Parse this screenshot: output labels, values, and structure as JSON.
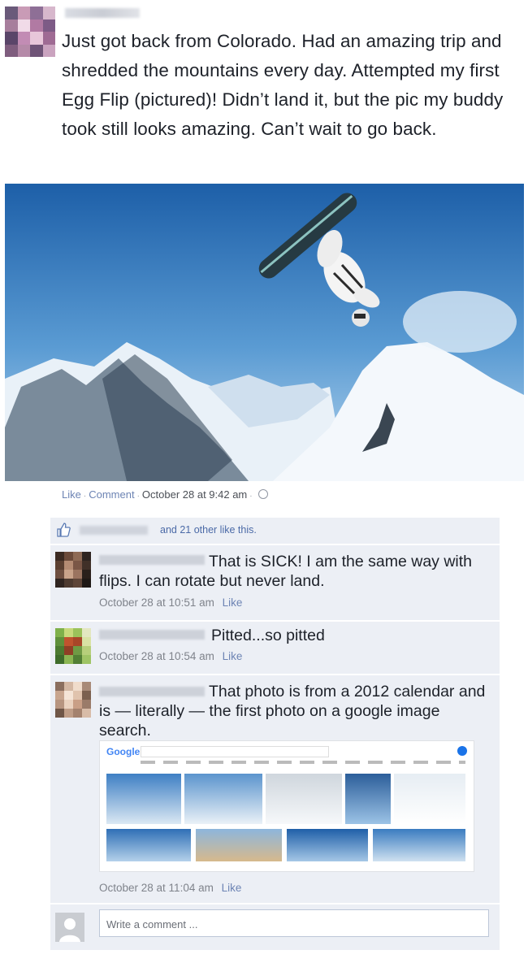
{
  "post": {
    "text": "Just got back from Colorado. Had an amazing trip and shredded the mountains every day. Attempted my first Egg Flip (pictured)! Didn’t land it, but the pic my buddy took still looks amazing. Can’t wait to go back.",
    "actions": {
      "like": "Like",
      "comment": "Comment",
      "timestamp": "October 28 at 9:42 am"
    }
  },
  "likes": {
    "text": "and 21 other like this."
  },
  "comments": [
    {
      "text": "That is SICK! I am the same way with flips. I can rotate but never land.",
      "time": "October 28 at 10:51 am",
      "like": "Like"
    },
    {
      "text": "Pitted...so pitted",
      "time": "October 28 at 10:54 am",
      "like": "Like"
    },
    {
      "text": "That photo is from a 2012 calendar and is — literally — the first photo on a google image search.",
      "time": "October 28 at 11:04 am",
      "like": "Like"
    }
  ],
  "google": {
    "logo": "Google"
  },
  "composer": {
    "placeholder": "Write a comment ..."
  },
  "colors": {
    "link": "#6d84b4",
    "panel": "#eceff5",
    "sky": "#2f73b8"
  }
}
